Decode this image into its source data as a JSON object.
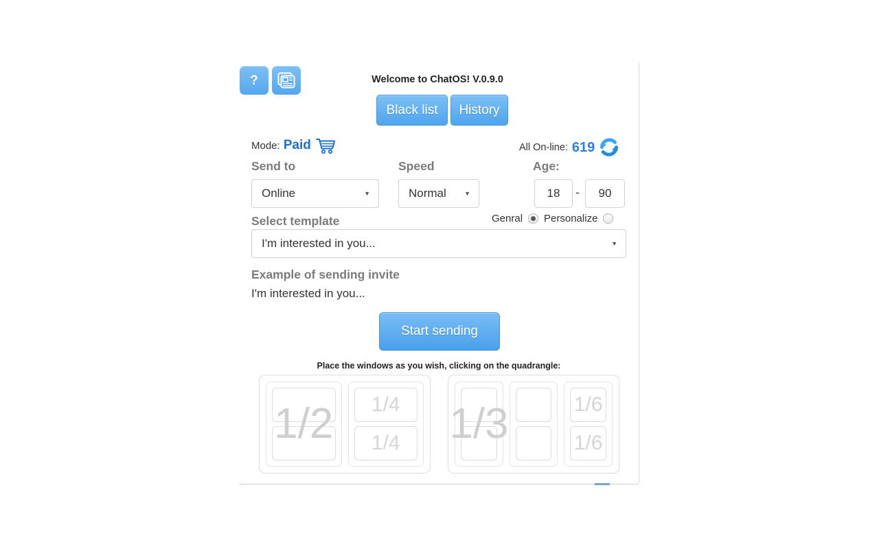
{
  "toolbar": {
    "help_label": "?",
    "help_icon": "question-mark-icon",
    "news_icon": "newspaper-icon"
  },
  "header": {
    "welcome": "Welcome to ChatOS! V.0.9.0",
    "blacklist_label": "Black list",
    "history_label": "History"
  },
  "mode": {
    "label": "Mode:",
    "value": "Paid",
    "icon": "shopping-cart-icon"
  },
  "online": {
    "label": "All On-line:",
    "count": "619",
    "refresh_icon": "refresh-icon",
    "count_color": "#2f7fe0"
  },
  "form": {
    "send_to_heading": "Send to",
    "send_to_value": "Online",
    "speed_heading": "Speed",
    "speed_value": "Normal",
    "age_heading": "Age:",
    "age_min": "18",
    "age_max": "90",
    "age_dash": "-",
    "genral_label": "Genral",
    "personalize_label": "Personalize",
    "genral_selected": true,
    "personalize_selected": false,
    "template_heading": "Select template",
    "template_value": "I'm interested in you...",
    "example_heading": "Example of sending invite",
    "example_text": "I'm interested in you...",
    "caret": "▼"
  },
  "actions": {
    "start_label": "Start sending"
  },
  "layout_picker": {
    "caption": "Place the windows as you wish, clicking on the quadrangle:",
    "groups": [
      {
        "name": "two-column-layout",
        "columns": [
          {
            "overlay": "1/2",
            "cells": [
              "",
              ""
            ]
          },
          {
            "overlay": "",
            "cells": [
              "1/4",
              "1/4"
            ]
          }
        ]
      },
      {
        "name": "three-column-layout",
        "columns": [
          {
            "overlay": "1/3",
            "cells": [
              "",
              ""
            ]
          },
          {
            "overlay": "",
            "cells": [
              "",
              ""
            ]
          },
          {
            "overlay": "",
            "cells": [
              "1/6",
              "1/6"
            ]
          }
        ]
      }
    ]
  },
  "colors": {
    "accent_blue": "#4ea4ec",
    "link_blue": "#1f6fd0",
    "heading_gray": "#7b7b7b"
  }
}
